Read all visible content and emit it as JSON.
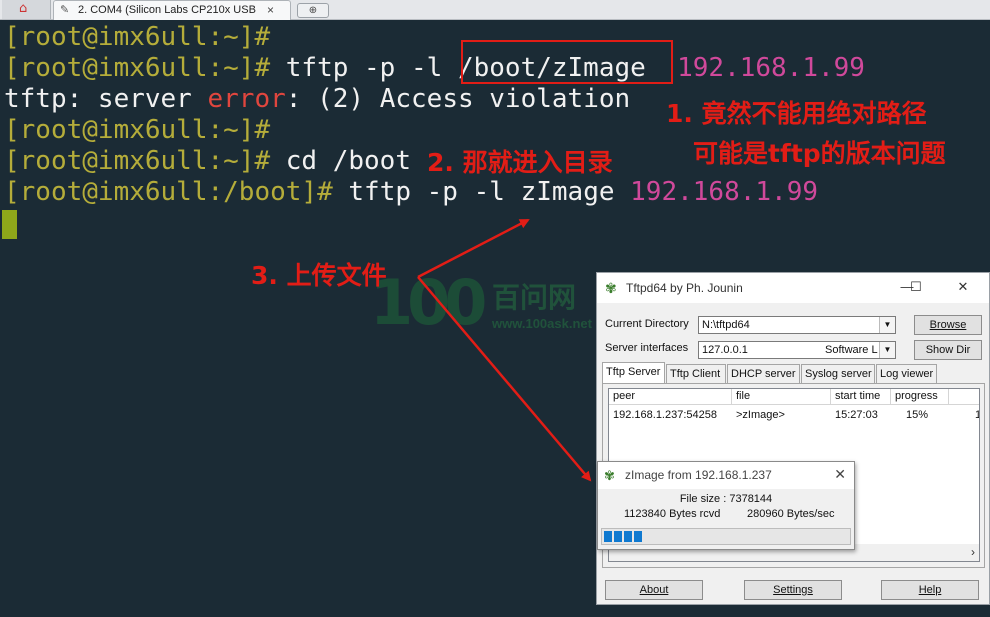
{
  "tabbar": {
    "home_icon": "home-icon",
    "active_tab_label": "2. COM4  (Silicon Labs CP210x USB",
    "close_glyph": "×",
    "new_tab_glyph": "⊕"
  },
  "terminal": {
    "lines": [
      {
        "prompt": "[root@imx6ull:~]#",
        "cmd": "",
        "ip": ""
      },
      {
        "prompt": "[root@imx6ull:~]#",
        "cmd": " tftp -p -l /boot/zImage  ",
        "ip": "192.168.1.99"
      },
      {
        "pre": "tftp: server ",
        "err": "error",
        "post": ": (2) Access violation"
      },
      {
        "prompt": "[root@imx6ull:~]#",
        "cmd": "",
        "ip": ""
      },
      {
        "prompt": "[root@imx6ull:~]#",
        "cmd": " cd /boot",
        "ip": ""
      },
      {
        "prompt": "[root@imx6ull:/boot]#",
        "cmd": " tftp -p -l zImage ",
        "ip": "192.168.1.99"
      }
    ],
    "colors": {
      "background": "#1b2b35",
      "prompt": "#b5ad3a",
      "ip": "#d0499b",
      "error": "#e0463e",
      "cursor": "#8ea71a"
    }
  },
  "annotations": {
    "note1_line1": "1. 竟然不能用绝对路径",
    "note1_line2": "可能是tftp的版本问题",
    "note2": "2. 那就进入目录",
    "note3": "3. 上传文件",
    "color": "#e21d16"
  },
  "watermark": {
    "num": "100",
    "cn": "百问网",
    "url": "www.100ask.net"
  },
  "tftpd": {
    "title": "Tftpd64 by Ph. Jounin",
    "current_directory_label": "Current Directory",
    "current_directory_value": "N:\\tftpd64",
    "server_interfaces_label": "Server interfaces",
    "server_interface_value": "127.0.0.1",
    "server_interface_desc": "Software L",
    "browse_label": "Browse",
    "showdir_label": "Show Dir",
    "tabs": [
      "Tftp Server",
      "Tftp Client",
      "DHCP server",
      "Syslog server",
      "Log viewer"
    ],
    "columns": [
      "peer",
      "file",
      "start time",
      "progress",
      ""
    ],
    "row": {
      "peer": "192.168.1.237:54258",
      "file": ">zImage>",
      "start_time": "15:27:03",
      "progress": "15%",
      "extra": "1"
    },
    "about_label": "About",
    "settings_label": "Settings",
    "help_label": "Help",
    "window_buttons": {
      "minimize": "—",
      "maximize": "☐",
      "close": "✕"
    }
  },
  "progress_dialog": {
    "title": "zImage from 192.168.1.237",
    "file_size": "File size : 7378144",
    "received": "1123840 Bytes rcvd",
    "rate": "280960 Bytes/sec",
    "progress_fraction": 0.15,
    "progress_segments": 4,
    "bar_color": "#0f79d0"
  }
}
